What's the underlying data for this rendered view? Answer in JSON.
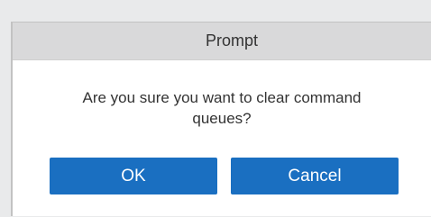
{
  "dialog": {
    "title": "Prompt",
    "message_line1": "Are you sure you want to clear command",
    "message_line2": "queues?",
    "ok_label": "OK",
    "cancel_label": "Cancel"
  },
  "colors": {
    "titlebar": "#d9d9da",
    "button": "#1a6fc1",
    "button_text": "#ffffff",
    "text": "#333333"
  }
}
